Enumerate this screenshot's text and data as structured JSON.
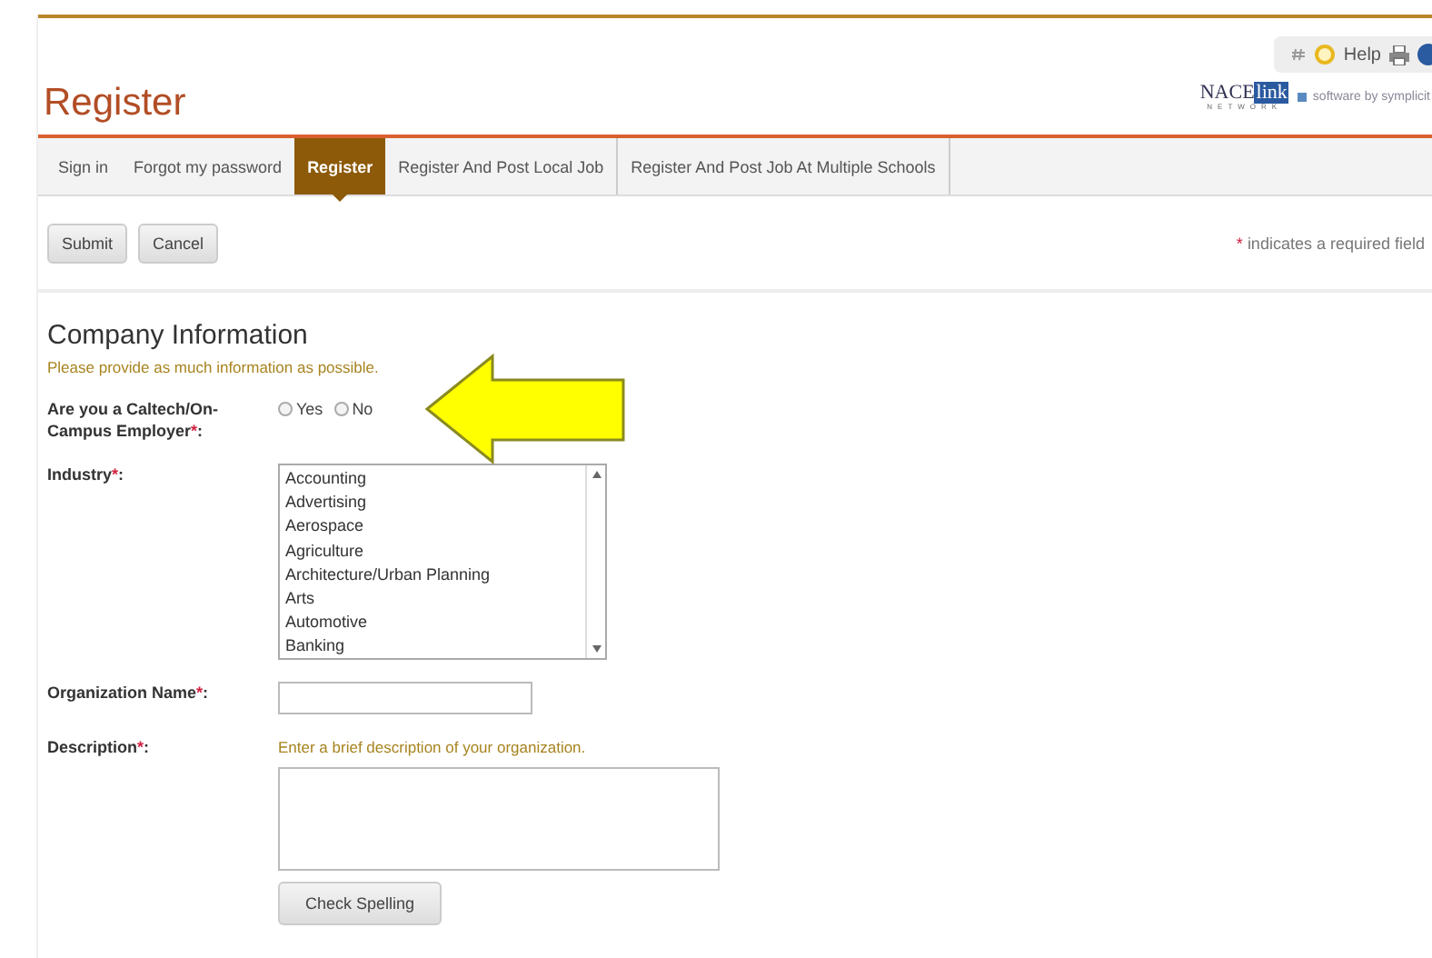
{
  "toolbar": {
    "help": "Help"
  },
  "logo": {
    "name": "NACE",
    "name_boxed": "link",
    "sub": "NETWORK",
    "tagline": "software by symplicit"
  },
  "title": "Register",
  "tabs": [
    {
      "label": "Sign in",
      "selected": false
    },
    {
      "label": "Forgot my password",
      "selected": false
    },
    {
      "label": "Register",
      "selected": true
    },
    {
      "label": "Register And Post Local Job",
      "selected": false
    },
    {
      "label": "Register And Post Job At Multiple Schools",
      "selected": false
    }
  ],
  "actions": [
    "Submit",
    "Cancel"
  ],
  "required_note": {
    "mark": "*",
    "text": "indicates a required field"
  },
  "section": {
    "title": "Company Information",
    "subtitle": "Please provide as much information as possible."
  },
  "fields": [
    {
      "kind": "radio",
      "label": "Are you a Caltech/On-Campus Employer",
      "mark": "*",
      "suffix": ":",
      "options": [
        {
          "label": "Yes",
          "selected": false
        },
        {
          "label": "No",
          "selected": false
        }
      ]
    },
    {
      "kind": "list",
      "label": "Industry",
      "mark": "*",
      "suffix": ":",
      "options": [
        "Accounting",
        "Advertising",
        "Aerospace",
        "Agriculture",
        "Architecture/Urban Planning",
        "Arts",
        "Automotive",
        "Banking"
      ]
    },
    {
      "kind": "text",
      "label": "Organization Name",
      "mark": "*",
      "suffix": ":"
    },
    {
      "kind": "textarea",
      "label": "Description",
      "mark": "*",
      "suffix": ":",
      "hint": "Enter a brief description of your organization.",
      "button": "Check Spelling"
    }
  ]
}
